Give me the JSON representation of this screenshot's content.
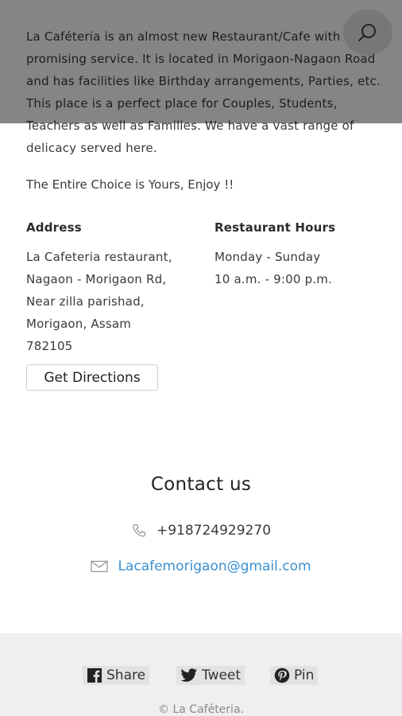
{
  "about": {
    "paragraph": "La Caféteria is an almost new Restaurant/Cafe with promising service. It is located in Morigaon-Nagaon Road and has facilities like Birthday arrangements, Parties, etc. This place is a perfect place for Couples, Students, Teachers as well as Families. We have a vast range of delicacy served here.",
    "tagline": "The Entire Choice is Yours, Enjoy !!"
  },
  "header": {
    "search_icon": "search-icon"
  },
  "address": {
    "title": "Address",
    "lines": [
      "La Cafeteria restaurant,",
      "Nagaon - Morigaon Rd,",
      "Near zilla parishad,",
      "Morigaon, Assam",
      "782105"
    ],
    "directions_label": "Get Directions"
  },
  "hours": {
    "title": "Restaurant Hours",
    "days": "Monday - Sunday",
    "time": "10 a.m. - 9:00 p.m."
  },
  "contact": {
    "title": "Contact us",
    "phone": "+918724929270",
    "email": "Lacafemorigaon@gmail.com",
    "link_color": "#3b8fcf"
  },
  "footer": {
    "share": "Share",
    "tweet": "Tweet",
    "pin": "Pin",
    "copyright": "© La Caféteria."
  }
}
